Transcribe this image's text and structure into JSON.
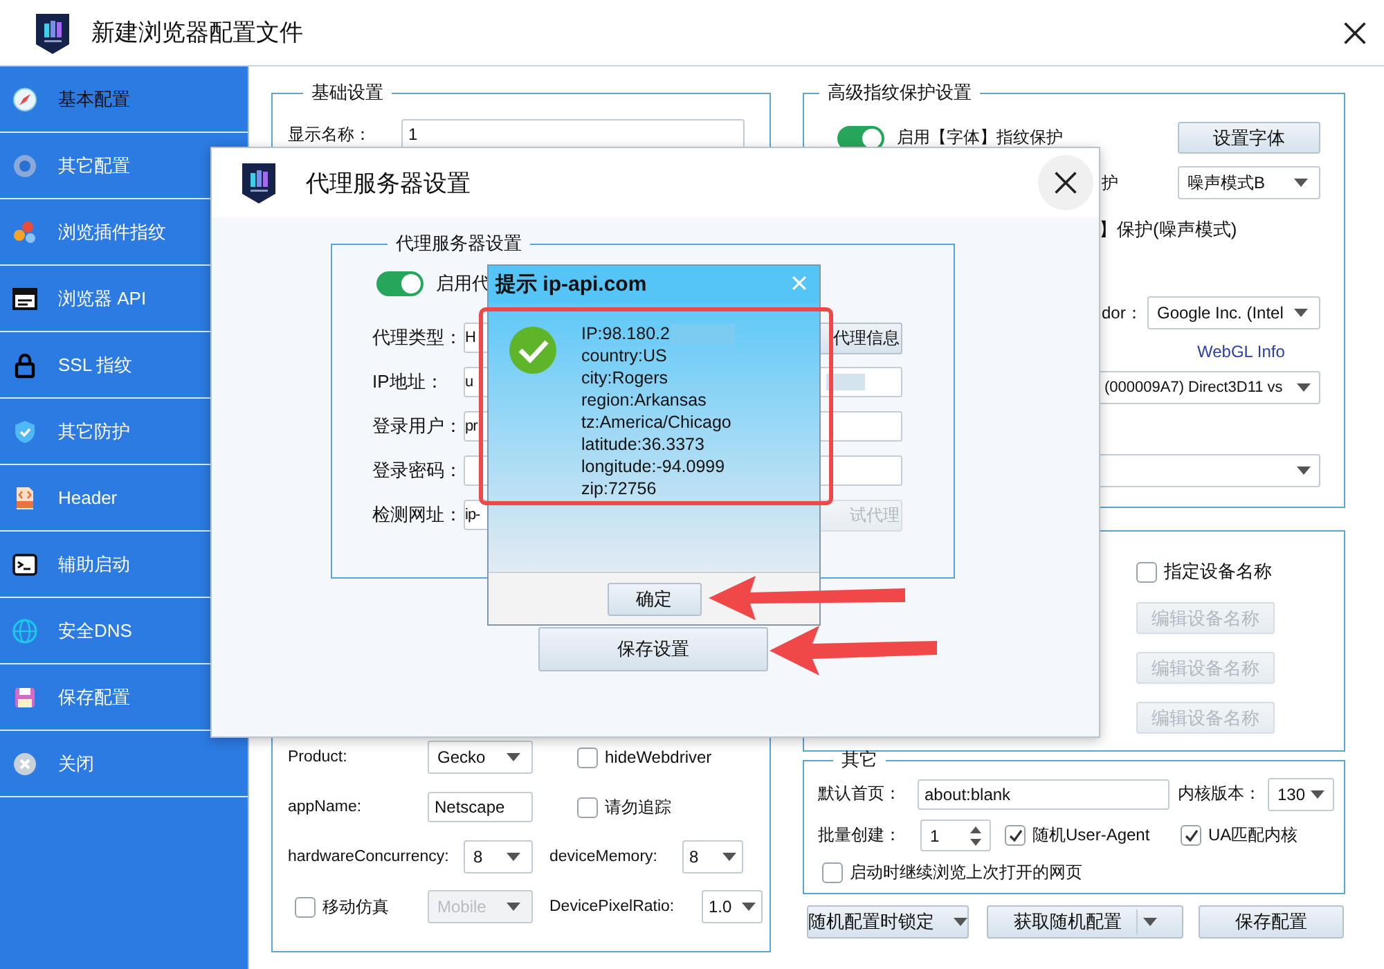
{
  "window": {
    "title": "新建浏览器配置文件"
  },
  "sidebar": {
    "items": [
      {
        "label": "基本配置",
        "kind": "compass",
        "selected": true
      },
      {
        "label": "其它配置",
        "kind": "browser",
        "selected": false
      },
      {
        "label": "浏览插件指纹",
        "kind": "gears",
        "selected": false
      },
      {
        "label": "浏览器 API",
        "kind": "api",
        "selected": false
      },
      {
        "label": "SSL 指纹",
        "kind": "lock",
        "selected": false
      },
      {
        "label": "其它防护",
        "kind": "shield",
        "selected": false
      },
      {
        "label": "Header",
        "kind": "html",
        "selected": false
      },
      {
        "label": "辅助启动",
        "kind": "cmd",
        "selected": false
      },
      {
        "label": "安全DNS",
        "kind": "dns",
        "selected": false
      },
      {
        "label": "保存配置",
        "kind": "save",
        "selected": false
      },
      {
        "label": "关闭",
        "kind": "close",
        "selected": false
      }
    ]
  },
  "basic_settings": {
    "title": "基础设置",
    "display_name": {
      "label": "显示名称：",
      "value": "1"
    },
    "rows": [
      [
        {
          "kind": "label",
          "text": "Product:"
        },
        {
          "kind": "select",
          "value": "Gecko",
          "disabled": false
        },
        {
          "kind": "checkbox",
          "text": "hideWebdriver",
          "checked": false
        }
      ],
      [
        {
          "kind": "label",
          "text": "appName:"
        },
        {
          "kind": "input",
          "value": "Netscape"
        },
        {
          "kind": "checkbox",
          "text": "请勿追踪",
          "checked": false
        }
      ],
      [
        {
          "kind": "label",
          "text": "hardwareConcurrency:"
        },
        {
          "kind": "select",
          "value": "8",
          "disabled": false
        },
        {
          "kind": "label",
          "text": "deviceMemory:"
        },
        {
          "kind": "select",
          "value": "8",
          "disabled": false
        }
      ],
      [
        {
          "kind": "checkbox",
          "text": "移动仿真",
          "checked": false
        },
        {
          "kind": "select",
          "value": "Mobile",
          "disabled": true
        },
        {
          "kind": "label",
          "text": "DevicePixelRatio:"
        },
        {
          "kind": "select",
          "value": "1.0",
          "disabled": false
        }
      ]
    ]
  },
  "advanced": {
    "title": "高级指纹保护设置",
    "font_protection": {
      "label": "启用【字体】指纹保护",
      "on": true,
      "button": "设置字体"
    },
    "noise_row": {
      "label": "护",
      "select": "噪声模式B"
    },
    "noise_note": "】保护(噪声模式)",
    "vendor": {
      "label": "dor：",
      "select": "Google Inc. (Intel"
    },
    "webgl_link": "WebGL Info",
    "renderer_select": "(000009A7) Direct3D11 vs",
    "blank_select": {
      "disabled": false
    }
  },
  "device": {
    "name_checkbox": {
      "label": "指定设备名称",
      "checked": false
    },
    "buttons": [
      {
        "label": "编辑设备名称",
        "disabled": true
      },
      {
        "label": "编辑设备名称",
        "disabled": true
      },
      {
        "label": "编辑设备名称",
        "disabled": true
      }
    ]
  },
  "other": {
    "title": "其它",
    "homepage": {
      "label": "默认首页：",
      "value": "about:blank"
    },
    "kernel": {
      "label": "内核版本：",
      "value": "130"
    },
    "batch": {
      "label": "批量创建：",
      "value": "1"
    },
    "checkboxes": [
      {
        "label": "随机User-Agent",
        "checked": true
      },
      {
        "label": "UA匹配内核",
        "checked": true
      }
    ],
    "restore": {
      "label": "启动时继续浏览上次打开的网页",
      "checked": false
    }
  },
  "footer_buttons": [
    {
      "label": "随机配置时锁定",
      "kind": "split"
    },
    {
      "label": "获取随机配置",
      "kind": "split"
    },
    {
      "label": "保存配置",
      "kind": "plain"
    }
  ],
  "proxy_dialog": {
    "title": "代理服务器设置",
    "group_title": "代理服务器设置",
    "enable": {
      "label": "启用代",
      "on": true
    },
    "rows": [
      {
        "label": "代理类型：",
        "value": "H"
      },
      {
        "label": "IP地址：",
        "value": "u"
      },
      {
        "label": "登录用户：",
        "value": "pr"
      },
      {
        "label": "登录密码："
      },
      {
        "label": "检测网址：",
        "value": "ip-"
      }
    ],
    "info_button": "代理信息",
    "test_button": {
      "label": "试代理",
      "disabled": true
    },
    "save_button": "保存设置"
  },
  "message_box": {
    "title": "提示 ip-api.com",
    "lines": [
      "IP:98.180.2",
      "country:US",
      "city:Rogers",
      "region:Arkansas",
      "tz:America/Chicago",
      "latitude:36.3373",
      "longitude:-94.0999",
      "zip:72756"
    ],
    "ok_button": "确定"
  }
}
